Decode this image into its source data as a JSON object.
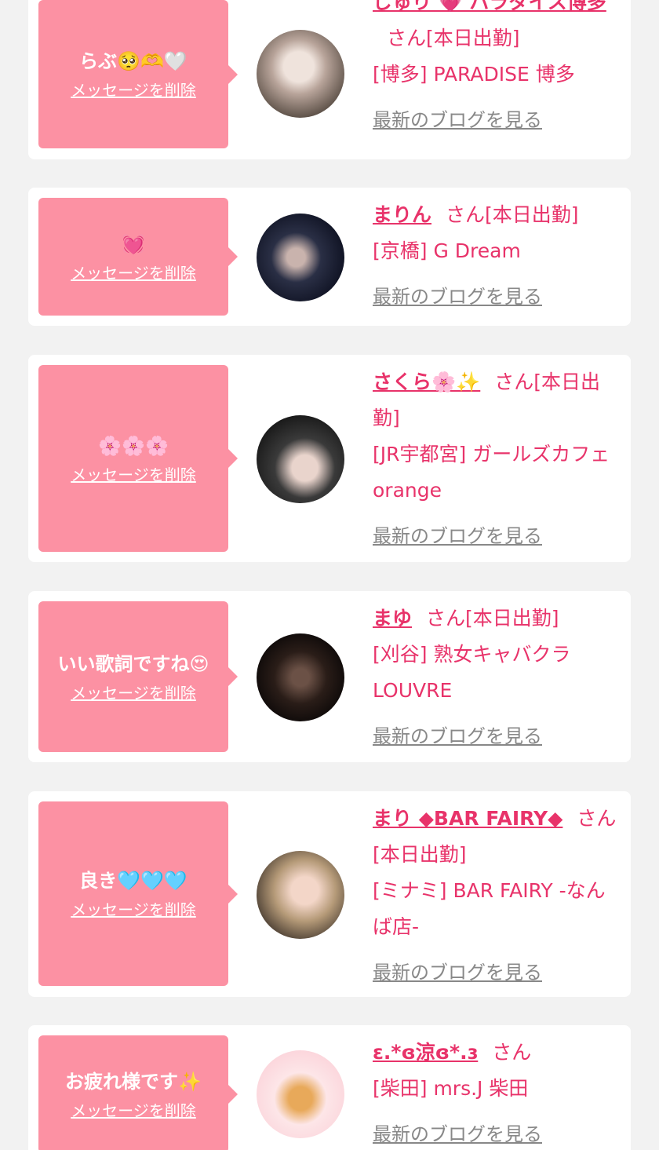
{
  "delete_label": "メッセージを削除",
  "san_label": "さん",
  "blog_label": "最新のブログを見る",
  "cards": [
    {
      "message": "らぶ🥺🫶🤍",
      "name": "じゅり 💗 パラダイス博多",
      "status": "[本日出勤]",
      "shop": "[博多] PARADISE 博多"
    },
    {
      "message": "💓",
      "name": "まりん",
      "status": "[本日出勤]",
      "shop": "[京橋] G Dream"
    },
    {
      "message": "🌸🌸🌸",
      "name": "さくら🌸✨",
      "status": "[本日出勤]",
      "shop": "[JR宇都宮] ガールズカフェ orange"
    },
    {
      "message": "いい歌詞ですね😍",
      "name": "まゆ",
      "status": "[本日出勤]",
      "shop": "[刈谷] 熟女キャバクラ LOUVRE"
    },
    {
      "message": "良き🩵🩵🩵",
      "name": "まり ◆BAR FAIRY◆",
      "status": "[本日出勤]",
      "shop": "[ミナミ] BAR FAIRY -なんば店-"
    },
    {
      "message": "お疲れ様です✨",
      "name": "ɛ.*ɞ涼ɞ*.ɜ",
      "status": "",
      "shop": "[柴田] mrs.J 柴田"
    }
  ]
}
